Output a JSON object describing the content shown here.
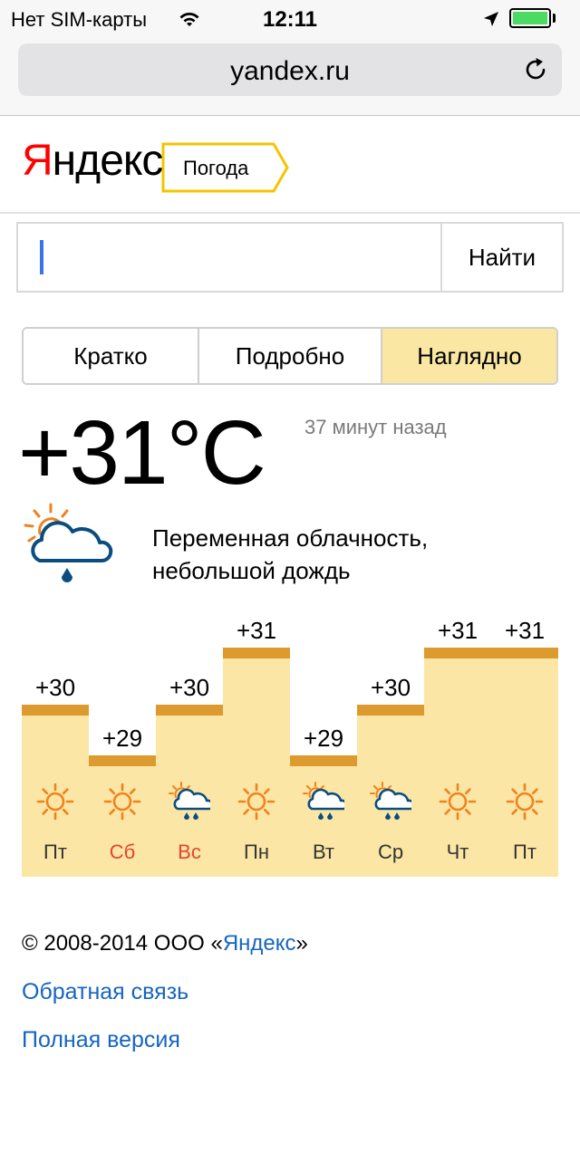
{
  "status_bar": {
    "carrier": "Нет SIM-карты",
    "time": "12:11",
    "battery_color": "#4cd964"
  },
  "browser": {
    "url": "yandex.ru"
  },
  "header": {
    "logo_first_letter": "Я",
    "logo_rest": "ндекс",
    "service": "Погода"
  },
  "search": {
    "value": "",
    "placeholder": "",
    "button": "Найти"
  },
  "tabs": [
    {
      "label": "Кратко",
      "active": false
    },
    {
      "label": "Подробно",
      "active": false
    },
    {
      "label": "Наглядно",
      "active": true
    }
  ],
  "current": {
    "temperature": "+31°C",
    "updated": "37 минут назад",
    "condition_line1": "Переменная облачность,",
    "condition_line2": "небольшой дождь",
    "icon": "partly-cloudy-rain-icon"
  },
  "forecast": [
    {
      "temp": "+30",
      "temp_value": 30,
      "icon": "sun-icon",
      "day": "Пт",
      "weekend": false
    },
    {
      "temp": "+29",
      "temp_value": 29,
      "icon": "sun-icon",
      "day": "Сб",
      "weekend": true
    },
    {
      "temp": "+30",
      "temp_value": 30,
      "icon": "cloud-rain-icon",
      "day": "Вс",
      "weekend": true
    },
    {
      "temp": "+31",
      "temp_value": 31,
      "icon": "sun-icon",
      "day": "Пн",
      "weekend": false
    },
    {
      "temp": "+29",
      "temp_value": 29,
      "icon": "cloud-rain-icon",
      "day": "Вт",
      "weekend": false
    },
    {
      "temp": "+30",
      "temp_value": 30,
      "icon": "cloud-rain-icon",
      "day": "Ср",
      "weekend": false
    },
    {
      "temp": "+31",
      "temp_value": 31,
      "icon": "sun-icon",
      "day": "Чт",
      "weekend": false
    },
    {
      "temp": "+31",
      "temp_value": 31,
      "icon": "sun-icon",
      "day": "Пт",
      "weekend": false
    }
  ],
  "colors": {
    "bar_fill": "#fbe6a5",
    "bar_cap": "#dd9a2e",
    "link": "#1565c0",
    "logo_red": "#ff0000",
    "active_tab": "#fbe7a4"
  },
  "footer": {
    "copyright_prefix": "© 2008-2014  ООО «",
    "copyright_link": "Яндекс",
    "copyright_suffix": "»",
    "feedback": "Обратная связь",
    "full_version": "Полная версия"
  }
}
